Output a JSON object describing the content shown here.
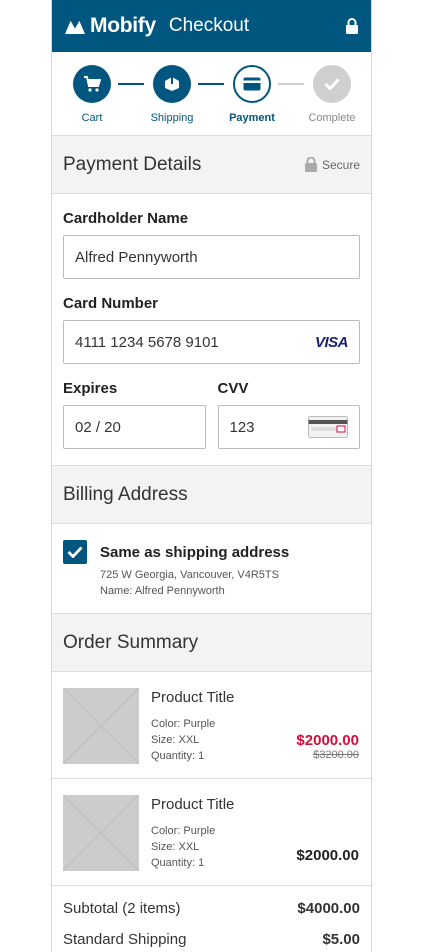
{
  "header": {
    "brand": "Mobify",
    "title": "Checkout"
  },
  "steps": [
    {
      "label": "Cart",
      "state": "done",
      "icon": "cart-icon"
    },
    {
      "label": "Shipping",
      "state": "done",
      "icon": "box-icon"
    },
    {
      "label": "Payment",
      "state": "active",
      "icon": "card-icon"
    },
    {
      "label": "Complete",
      "state": "pending",
      "icon": "check-icon"
    }
  ],
  "payment": {
    "heading": "Payment Details",
    "secure_label": "Secure",
    "cardholder_label": "Cardholder Name",
    "cardholder_value": "Alfred Pennyworth",
    "card_number_label": "Card Number",
    "card_number_value": "4111 1234 5678 9101",
    "card_brand": "VISA",
    "expires_label": "Expires",
    "expires_value": "02 / 20",
    "cvv_label": "CVV",
    "cvv_value": "123"
  },
  "billing": {
    "heading": "Billing Address",
    "same_as_shipping_label": "Same as shipping address",
    "same_as_shipping_checked": true,
    "address": "725 W Georgia, Vancouver, V4R5TS",
    "name": "Name: Alfred Pennyworth"
  },
  "order": {
    "heading": "Order Summary",
    "items": [
      {
        "title": "Product Title",
        "color": "Color: Purple",
        "size": "Size: XXL",
        "quantity": "Quantity: 1",
        "price": "$2000.00",
        "was_price": "$3200.00"
      },
      {
        "title": "Product Title",
        "color": "Color: Purple",
        "size": "Size: XXL",
        "quantity": "Quantity: 1",
        "price": "$2000.00",
        "was_price": ""
      }
    ],
    "subtotal_label": "Subtotal (2 items)",
    "subtotal_value": "$4000.00",
    "shipping_label": "Standard Shipping",
    "shipping_value": "$5.00"
  },
  "colors": {
    "brand": "#00567f",
    "sale": "#d0103a",
    "pending": "#cfcfcf"
  }
}
